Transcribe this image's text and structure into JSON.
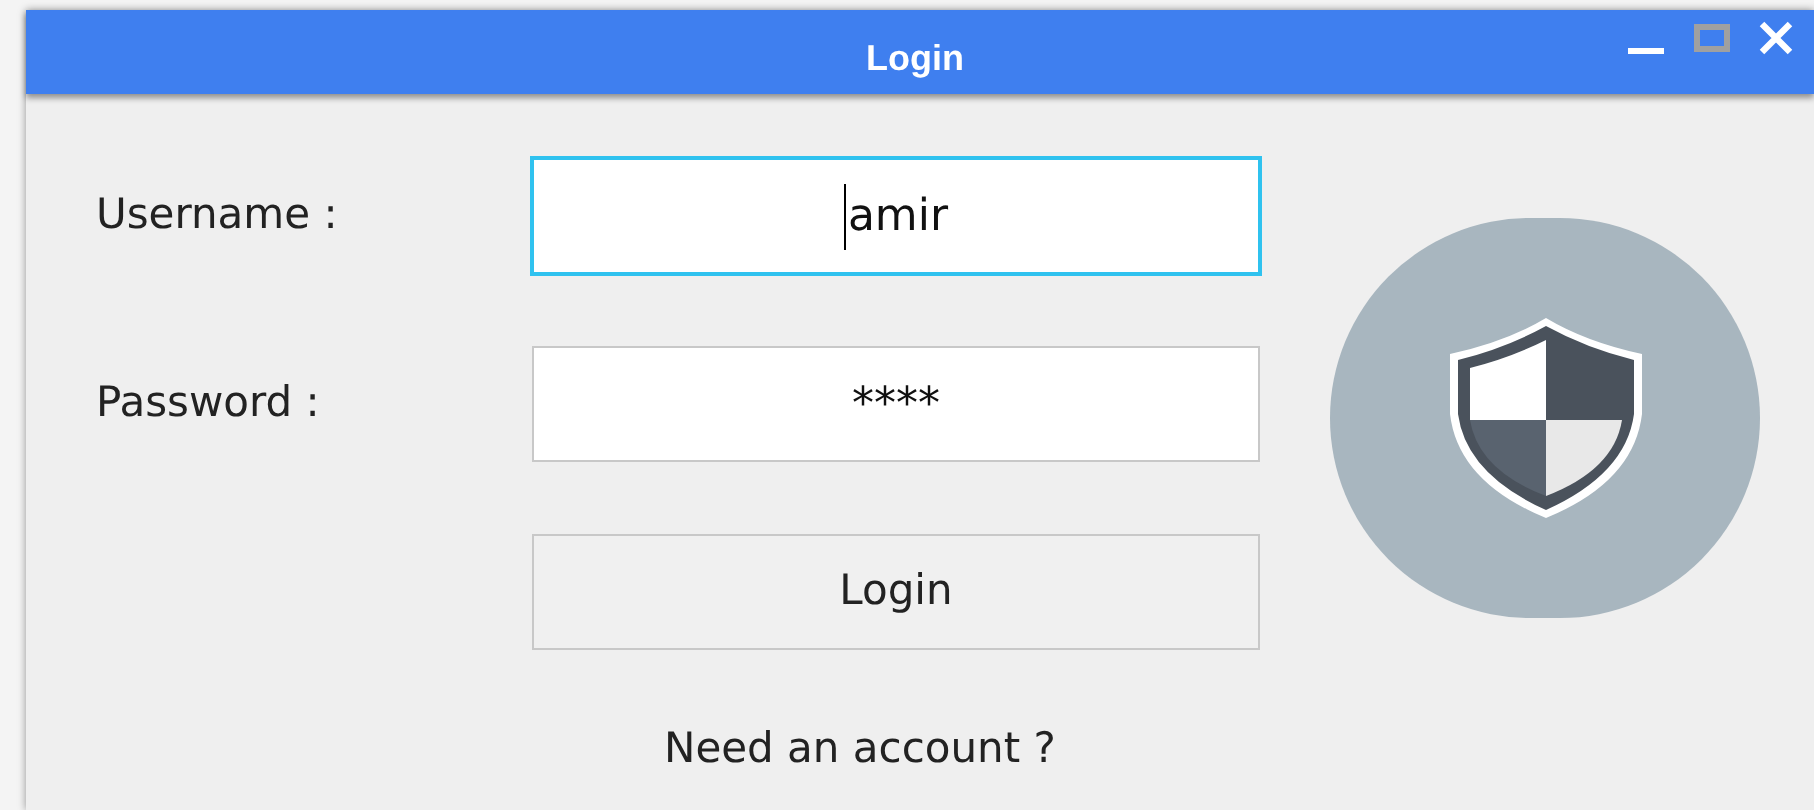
{
  "window": {
    "title": "Login",
    "controls": [
      {
        "kind": "minimize",
        "disabled": false
      },
      {
        "kind": "maximize",
        "disabled": true
      },
      {
        "kind": "close",
        "disabled": false
      }
    ]
  },
  "fields": [
    {
      "label": "Username :",
      "value": "amir",
      "focused": true
    },
    {
      "label": "Password :",
      "value": "****",
      "focused": false
    }
  ],
  "login_button": "Login",
  "account_link": "Need an account ?"
}
